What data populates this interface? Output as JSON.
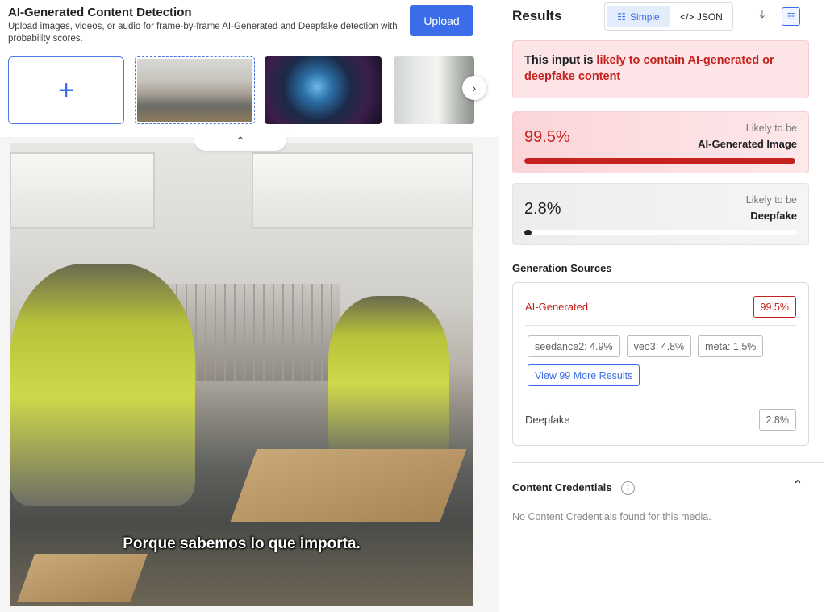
{
  "header": {
    "title": "AI-Generated Content Detection",
    "subtitle": "Upload images, videos, or audio for frame-by-frame AI-Generated and Deepfake detection with probability scores.",
    "upload_label": "Upload"
  },
  "thumbnails": {
    "add_icon": "plus-icon",
    "next_icon": "chevron-right-icon",
    "collapse_icon": "chevron-up-icon"
  },
  "preview": {
    "caption": "Porque sabemos lo que importa."
  },
  "results": {
    "title": "Results",
    "view_simple": "Simple",
    "view_json": "</> JSON",
    "verdict_prefix": "This input is ",
    "verdict_highlight": "likely to contain AI-generated or deepfake content"
  },
  "scores": {
    "ai": {
      "value": "99.5%",
      "likely": "Likely to be",
      "kind": "AI-Generated Image",
      "fraction": 0.995
    },
    "deepfake": {
      "value": "2.8%",
      "likely": "Likely to be",
      "kind": "Deepfake",
      "fraction": 0.028
    }
  },
  "generation": {
    "title": "Generation Sources",
    "ai_label": "AI-Generated",
    "ai_value": "99.5%",
    "chips": [
      "seedance2: 4.9%",
      "veo3: 4.8%",
      "meta: 1.5%"
    ],
    "more_label": "View 99 More Results",
    "deepfake_label": "Deepfake",
    "deepfake_value": "2.8%"
  },
  "credentials": {
    "title": "Content Credentials",
    "empty_text": "No Content Credentials found for this media."
  },
  "colors": {
    "accent": "#3b6de8",
    "danger": "#c5221f"
  }
}
